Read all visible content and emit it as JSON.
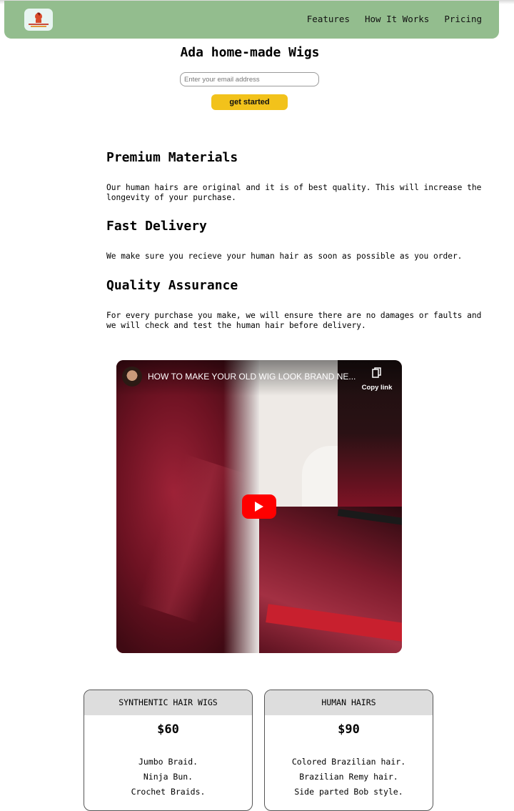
{
  "header": {
    "nav": [
      "Features",
      "How It Works",
      "Pricing"
    ]
  },
  "hero": {
    "title": "Ada home-made Wigs",
    "email_placeholder": "Enter your email address",
    "cta_label": "get started"
  },
  "features": [
    {
      "title": "Premium Materials",
      "text": "Our human hairs are original and it is of best quality. This will increase the longevity of your purchase."
    },
    {
      "title": "Fast Delivery",
      "text": "We make sure you recieve your human hair as soon as possible as you order."
    },
    {
      "title": "Quality Assurance",
      "text": "For every purchase you make, we will ensure there are no damages or faults and we will check and test the human hair before delivery."
    }
  ],
  "video": {
    "title": "HOW TO MAKE YOUR OLD WIG LOOK BRAND NE...",
    "copy_link": "Copy link"
  },
  "pricing": [
    {
      "name": "SYNTHENTIC HAIR WIGS",
      "price": "$60",
      "items": [
        "Jumbo Braid.",
        "Ninja Bun.",
        "Crochet Braids."
      ]
    },
    {
      "name": "HUMAN HAIRS",
      "price": "$90",
      "items": [
        "Colored Brazilian hair.",
        "Brazilian Remy hair.",
        "Side parted Bob style."
      ]
    }
  ],
  "colors": {
    "navbar": "#93bd8e",
    "cta": "#f2c21b",
    "play": "#ff0000"
  }
}
